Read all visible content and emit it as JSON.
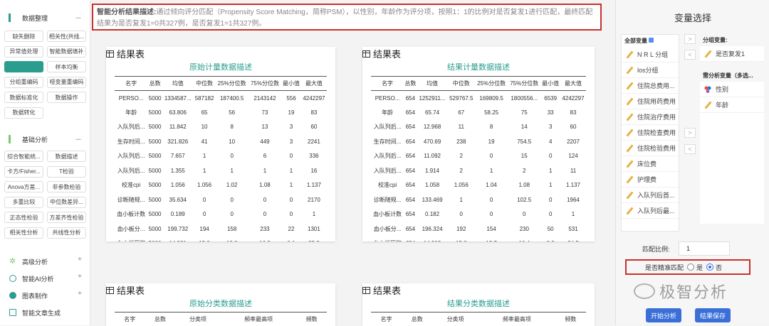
{
  "sidebar": {
    "data_section": "数据整理",
    "data_buttons": [
      "缺失删除",
      "相关性(共线...",
      "异常值处理",
      "智能数据填补",
      "",
      "样本均衡",
      "分组重编码",
      "哑变量重编码",
      "数据标准化",
      "数据操作",
      "数据转化"
    ],
    "basic_section": "基础分析",
    "basic_buttons": [
      "综合智能统...",
      "数据描述",
      "卡方/Fisher...",
      "T检验",
      "Anova方差...",
      "非参数检验",
      "多重比较",
      "中位数差异...",
      "正态性检验",
      "方差齐性检验",
      "相关性分析",
      "共线性分析"
    ],
    "advanced": "高级分析",
    "smart_ai": "智能AI分析",
    "charts": "图表制作",
    "article": "智能文章生成",
    "collapse_glyph": "－",
    "expand_glyph": "+"
  },
  "banner": {
    "label": "智能分析结果描述:",
    "text": "通过倾向评分匹配（Propensity Score Matching，简称PSM），以性别，年龄作为评分项，按照1：1的比例对是否复发1进行匹配，最终匹配结果为是否复发1=0共327例，是否复发1=1共327例。"
  },
  "cards": {
    "result_title": "结果表",
    "orig_sub": "原始计量数据描述",
    "match_sub": "结果计量数据描述",
    "orig_cat_sub": "原始分类数据描述",
    "match_cat_sub": "结果分类数据描述"
  },
  "num_headers": [
    "名字",
    "总数",
    "均值",
    "中位数",
    "25%分位数",
    "75%分位数",
    "最小值",
    "最大值"
  ],
  "orig_rows": [
    [
      "PERSO...",
      "5000",
      "1334587...",
      "587182",
      "187400.5",
      "2143142",
      "556",
      "4242297"
    ],
    [
      "年龄",
      "5000",
      "63.806",
      "65",
      "56",
      "73",
      "19",
      "83"
    ],
    [
      "入队列后...",
      "5000",
      "11.842",
      "10",
      "8",
      "13",
      "3",
      "60"
    ],
    [
      "生存时间...",
      "5000",
      "321.826",
      "41",
      "10",
      "449",
      "3",
      "2241"
    ],
    [
      "入队列后...",
      "5000",
      "7.657",
      "1",
      "0",
      "6",
      "0",
      "336"
    ],
    [
      "入队列后...",
      "5000",
      "1.355",
      "1",
      "1",
      "1",
      "1",
      "16"
    ],
    [
      "校准cpi",
      "5000",
      "1.056",
      "1.056",
      "1.02",
      "1.08",
      "1",
      "1.137"
    ],
    [
      "诊断随规...",
      "5000",
      "35.634",
      "0",
      "0",
      "0",
      "0",
      "2170"
    ],
    [
      "血小板计数",
      "5000",
      "0.189",
      "0",
      "0",
      "0",
      "0",
      "1"
    ],
    [
      "血小板分...",
      "5000",
      "199.732",
      "194",
      "158",
      "233",
      "22",
      "1301"
    ],
    [
      "血小板压积",
      "5000",
      "14.931",
      "15.8",
      "12.8",
      "16.3",
      "8.1",
      "25.2"
    ]
  ],
  "match_rows": [
    [
      "PERSO...",
      "654",
      "1252911...",
      "529767.5",
      "169809.5",
      "1800556...",
      "6539",
      "4242297"
    ],
    [
      "年龄",
      "654",
      "65.74",
      "67",
      "58.25",
      "75",
      "33",
      "83"
    ],
    [
      "入队列后...",
      "654",
      "12.968",
      "11",
      "8",
      "14",
      "3",
      "60"
    ],
    [
      "生存时间...",
      "654",
      "470.69",
      "238",
      "19",
      "754.5",
      "4",
      "2207"
    ],
    [
      "入队列后...",
      "654",
      "11.092",
      "2",
      "0",
      "15",
      "0",
      "124"
    ],
    [
      "入队列后...",
      "654",
      "1.914",
      "2",
      "1",
      "2",
      "1",
      "11"
    ],
    [
      "校准cpi",
      "654",
      "1.058",
      "1.056",
      "1.04",
      "1.08",
      "1",
      "1.137"
    ],
    [
      "诊断随规...",
      "654",
      "133.469",
      "1",
      "0",
      "102.5",
      "0",
      "1964"
    ],
    [
      "血小板计数",
      "654",
      "0.182",
      "0",
      "0",
      "0",
      "0",
      "1"
    ],
    [
      "血小板分...",
      "654",
      "196.324",
      "192",
      "154",
      "230",
      "50",
      "531"
    ],
    [
      "血小板压积",
      "654",
      "14.903",
      "15.8",
      "12.7",
      "16.4",
      "8.3",
      "24.5"
    ]
  ],
  "cat_headers": [
    "名字",
    "总数",
    "分类项",
    "频率最高项",
    "频数"
  ],
  "right": {
    "title": "变量选择",
    "all_vars": "全部变量",
    "all_list": [
      "N R L 分组",
      "los分组",
      "住院总费用...",
      "住院用药费用",
      "住院治疗费用",
      "住院检查费用",
      "住院检验费用",
      "床位费",
      "护理费",
      "入队列后首...",
      "入队列后最..."
    ],
    "group_var": "分组变量:",
    "group_list": [
      "是否复发1"
    ],
    "need_var": "需分析变量（多选...",
    "need_list": [
      "性别",
      "年龄"
    ],
    "arrow_right": ">",
    "arrow_left": "<",
    "ratio_label": "匹配比例:",
    "ratio_value": "1",
    "exact_label": "是否精准匹配",
    "opt_yes": "是",
    "opt_no": "否",
    "start_btn": "开始分析",
    "save_btn": "结果保存",
    "watermark": "极智分析"
  }
}
